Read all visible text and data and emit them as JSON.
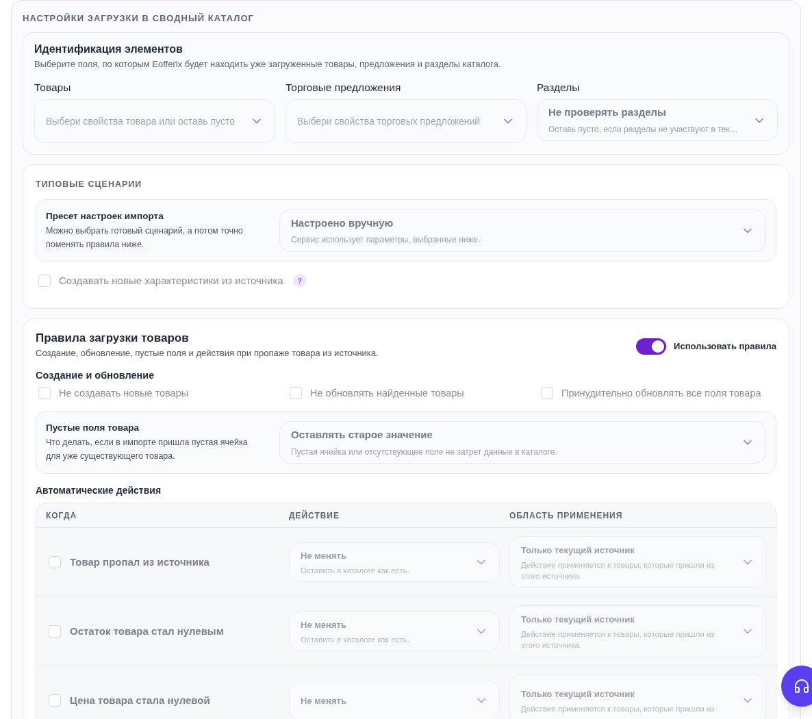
{
  "title": "НАСТРОЙКИ ЗАГРУЗКИ В СВОДНЫЙ КАТАЛОГ",
  "identification": {
    "title": "Идентификация элементов",
    "description": "Выберите поля, по которым Eofferix будет находить уже загруженные товары, предложения и разделы каталога.",
    "fields": [
      {
        "label": "Товары",
        "placeholder": "Выбери свойства товара или оставь пусто"
      },
      {
        "label": "Торговые предложения",
        "placeholder": "Выбери свойства торговых предложений"
      },
      {
        "label": "Разделы",
        "value": "Не проверять разделы",
        "hint": "Оставь пусто, если разделы не участвуют в тек…"
      }
    ]
  },
  "scenarios": {
    "title": "ТИПОВЫЕ СЦЕНАРИИ",
    "preset": {
      "title": "Пресет настроек импорта",
      "description": "Можно выбрать готовый сценарий, а потом точно поменять правила ниже.",
      "value": "Настроено вручную",
      "hint": "Сервис использует параметры, выбранные ниже."
    },
    "checkbox": {
      "label": "Создавать новые характеристики из источника",
      "checked": false,
      "help": "?"
    }
  },
  "rules": {
    "title": "Правила загрузки товаров",
    "description": "Создание, обновление, пустые поля и действия при пропаже товара из источника.",
    "toggle": {
      "label": "Использовать правила",
      "on": true
    },
    "creation_title": "Создание и обновление",
    "creation_options": [
      {
        "label": "Не создавать новые товары",
        "checked": false
      },
      {
        "label": "Не обновлять найденные товары",
        "checked": false
      },
      {
        "label": "Принудительно обновлять все поля товара",
        "checked": false
      }
    ],
    "empty_fields": {
      "title": "Пустые поля товара",
      "description": "Что делать, если в импорте пришла пустая ячейка для уже существующего товара.",
      "value": "Оставлять старое значение",
      "hint": "Пустая ячейка или отсутствующее поле не затрет данные в каталоге."
    },
    "actions_title": "Автоматические действия",
    "table": {
      "columns": [
        "КОГДА",
        "ДЕЙСТВИЕ",
        "ОБЛАСТЬ ПРИМЕНЕНИЯ"
      ],
      "rows": [
        {
          "when": "Товар пропал из источника",
          "checked": false,
          "disabled": true,
          "action": "Не менять",
          "action_hint": "Оставить в каталоге как есть.",
          "scope": "Только текущий источник",
          "scope_hint": "Действие применяется к товары, которые пришли из этого источника."
        },
        {
          "when": "Остаток товара стал нулевым",
          "checked": false,
          "disabled": true,
          "action": "Не менять",
          "action_hint": "Оставить в каталоге как есть.",
          "scope": "Только текущий источник",
          "scope_hint": "Действие применяется к товары, которые пришли из этого источника."
        },
        {
          "when": "Цена товара стала нулевой",
          "checked": false,
          "disabled": true,
          "action": "Не менять",
          "scope": "Только текущий источник",
          "scope_hint": "Действие применяется к товары, которые пришли из"
        }
      ]
    }
  }
}
